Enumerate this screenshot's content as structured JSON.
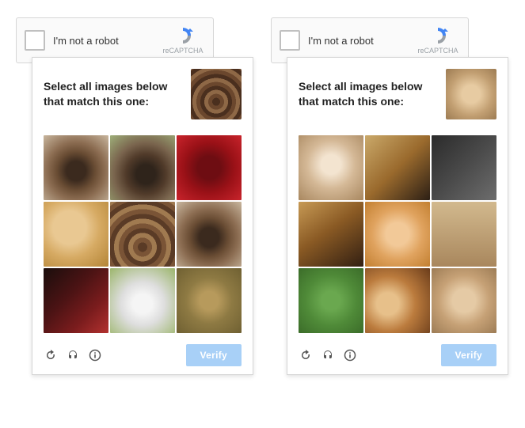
{
  "anchor": {
    "label": "I'm not a robot",
    "brand_text": "reCAPTCHA"
  },
  "prompt": {
    "line1": "Select all images below",
    "line2": "that match this one:"
  },
  "verify_label": "Verify",
  "units": [
    {
      "sample": "turkey",
      "cells": [
        {
          "name": "turkey-displaying-autumn",
          "css": "img-turkey"
        },
        {
          "name": "turkey-in-field",
          "css": "img-turkey2"
        },
        {
          "name": "cranberry-sauce-bowl",
          "css": "img-cranberry"
        },
        {
          "name": "dinner-rolls",
          "css": "img-rolls"
        },
        {
          "name": "turkey-feathers-spread",
          "css": "img-turkey-tail"
        },
        {
          "name": "turkey-displaying-grass",
          "css": "img-turkey"
        },
        {
          "name": "wine-and-cranberries",
          "css": "img-wine"
        },
        {
          "name": "white-turkey",
          "css": "img-turkey-white"
        },
        {
          "name": "stuffing-dish",
          "css": "img-stuffing"
        }
      ]
    },
    {
      "sample": "cat",
      "cells": [
        {
          "name": "kitten-paws-up",
          "css": "img-cat-cute"
        },
        {
          "name": "german-shepherd-stand",
          "css": "img-dog-gsd"
        },
        {
          "name": "dark-dog-standing",
          "css": "img-dog-dark"
        },
        {
          "name": "german-shepherd-walk",
          "css": "img-dog-gsd2"
        },
        {
          "name": "orange-kitten",
          "css": "img-kitten-orange"
        },
        {
          "name": "tabby-cat-lying",
          "css": "img-cat-lying"
        },
        {
          "name": "green-leafy-plant",
          "css": "img-green-plant"
        },
        {
          "name": "two-guinea-pigs",
          "css": "img-guineapigs"
        },
        {
          "name": "tabby-cat-closeup",
          "css": "img-cat-tabby3"
        }
      ]
    }
  ],
  "colors": {
    "anchor_border": "#d6d6d6",
    "anchor_bg": "#fafafa",
    "verify_bg": "#a8d0f7",
    "verify_fg": "#ffffff",
    "brand_blue": "#4285f4"
  }
}
